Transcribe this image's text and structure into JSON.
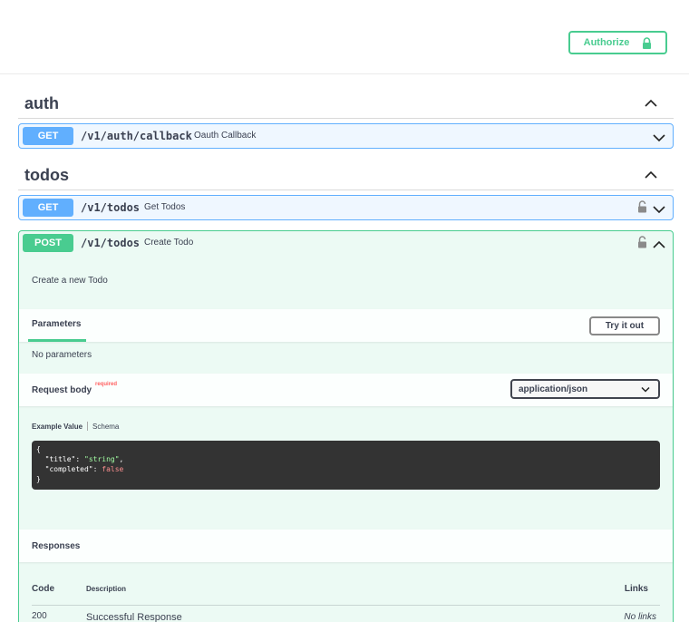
{
  "header": {
    "authorize_label": "Authorize"
  },
  "tags": [
    {
      "name": "auth",
      "operations": [
        {
          "method": "GET",
          "path": "/v1/auth/callback",
          "summary": "Oauth Callback"
        }
      ]
    },
    {
      "name": "todos",
      "operations": [
        {
          "method": "GET",
          "path": "/v1/todos",
          "summary": "Get Todos"
        },
        {
          "method": "POST",
          "path": "/v1/todos",
          "summary": "Create Todo",
          "description": "Create a new Todo",
          "parameters_tab": "Parameters",
          "try_it_out": "Try it out",
          "no_parameters": "No parameters",
          "request_body_label": "Request body",
          "required_label": "required",
          "content_type": "application/json",
          "example_value_tab": "Example Value",
          "schema_tab": "Schema",
          "example": {
            "open": "{",
            "title_key": "\"title\"",
            "title_value": "\"string\"",
            "completed_key": "\"completed\"",
            "completed_value": "false",
            "close": "}"
          },
          "responses_label": "Responses",
          "responses_columns": {
            "code": "Code",
            "description": "Description",
            "links": "Links"
          },
          "responses": [
            {
              "code": "200",
              "description": "Successful Response",
              "links": "No links"
            }
          ]
        }
      ]
    }
  ],
  "colors": {
    "get": "#61affe",
    "post": "#49cc90",
    "code_bg": "#333333"
  },
  "icons": [
    "lock-icon",
    "chevron-up-icon",
    "chevron-down-icon"
  ]
}
